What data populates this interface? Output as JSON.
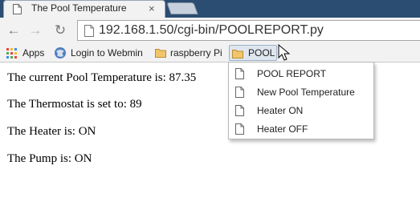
{
  "browser": {
    "tab": {
      "title": "The Pool Temperature",
      "close_glyph": "×"
    },
    "nav": {
      "back_glyph": "←",
      "forward_glyph": "→",
      "reload_glyph": "↻"
    },
    "address_bar": {
      "url": "192.168.1.50/cgi-bin/POOLREPORT.py"
    },
    "bookmarks": [
      {
        "label": "Apps",
        "icon": "apps-grid-icon"
      },
      {
        "label": "Login to Webmin",
        "icon": "webmin-icon"
      },
      {
        "label": "raspberry Pi",
        "icon": "folder-icon"
      },
      {
        "label": "POOL",
        "icon": "folder-icon"
      }
    ],
    "pool_menu": [
      {
        "label": "POOL REPORT",
        "icon": "document-icon"
      },
      {
        "label": "New Pool Temperature",
        "icon": "document-icon"
      },
      {
        "label": "Heater ON",
        "icon": "document-icon"
      },
      {
        "label": "Heater OFF",
        "icon": "document-icon"
      }
    ]
  },
  "page": {
    "lines": [
      "The current Pool Temperature is: 87.35",
      "The Thermostat is set to: 89",
      "The Heater is: ON",
      "The Pump is: ON"
    ]
  },
  "colors": {
    "tabstrip": "#2b4d72",
    "chrome": "#f2f2f2",
    "folder": "#f1c66b",
    "active_bookmark": "#dfe6ef"
  }
}
